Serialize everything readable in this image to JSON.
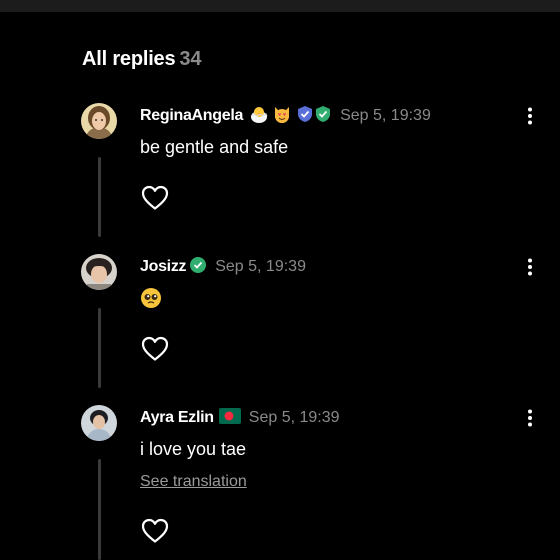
{
  "header": {
    "title": "All replies",
    "count": "34"
  },
  "replies": [
    {
      "username": "ReginaAngela",
      "time": "Sep 5, 19:39",
      "text": "be gentle and safe",
      "badges": [
        "hatching-chick-emoji",
        "heart-eyes-cat-emoji",
        "shield-badge",
        "verified-badge"
      ]
    },
    {
      "username": "Josizz",
      "time": "Sep 5, 19:39",
      "text": "🥹",
      "badges": [
        "verified-badge"
      ]
    },
    {
      "username": "Ayra Ezlin",
      "time": "Sep 5, 19:39",
      "text": "i love you tae",
      "translation": "See translation",
      "badges": [
        "bangladesh-flag"
      ]
    }
  ],
  "colors": {
    "background": "#000000",
    "muted_text": "#8a8a8a",
    "verified_green": "#2fae6f",
    "shield_blue": "#5a6fd8"
  },
  "icons": {
    "like": "heart-outline-icon",
    "more": "vertical-ellipsis-icon"
  }
}
